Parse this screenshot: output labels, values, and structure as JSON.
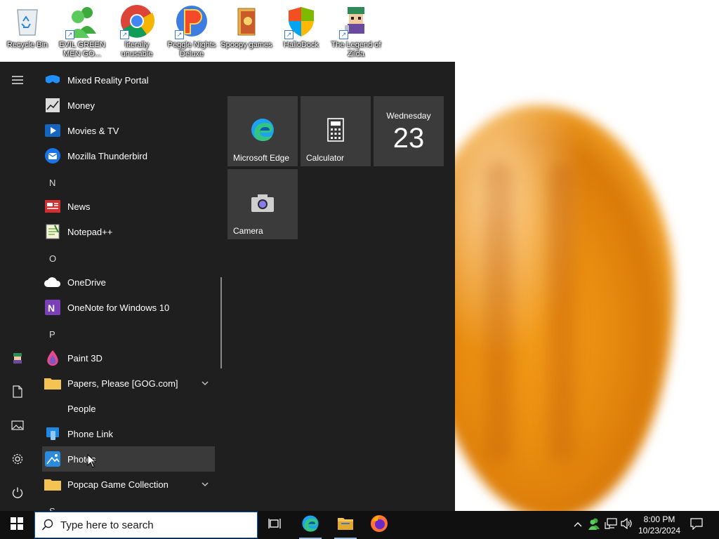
{
  "desktop": {
    "icons": [
      {
        "label": "Recycle Bin",
        "icon": "recycle-bin-icon"
      },
      {
        "label": "EVIL GREEN MEN GO...",
        "icon": "green-people-icon"
      },
      {
        "label": "literally unusable",
        "icon": "chrome-icon"
      },
      {
        "label": "Peggle Nights Deluxe",
        "icon": "peggle-icon"
      },
      {
        "label": "Spoopy games",
        "icon": "folder-icon"
      },
      {
        "label": "HalloDock",
        "icon": "shield-icon"
      },
      {
        "label": "The Legend of Zilda",
        "icon": "pixel-character-icon"
      }
    ]
  },
  "start_menu": {
    "apps": [
      {
        "label": "Mixed Reality Portal",
        "icon": "mixed-reality-icon"
      },
      {
        "label": "Money",
        "icon": "money-chart-icon"
      },
      {
        "label": "Movies & TV",
        "icon": "movies-tv-icon"
      },
      {
        "label": "Mozilla Thunderbird",
        "icon": "thunderbird-icon"
      },
      {
        "label": "N",
        "header": true
      },
      {
        "label": "News",
        "icon": "news-icon"
      },
      {
        "label": "Notepad++",
        "icon": "notepadpp-icon"
      },
      {
        "label": "O",
        "header": true
      },
      {
        "label": "OneDrive",
        "icon": "onedrive-icon"
      },
      {
        "label": "OneNote for Windows 10",
        "icon": "onenote-icon"
      },
      {
        "label": "P",
        "header": true
      },
      {
        "label": "Paint 3D",
        "icon": "paint3d-icon"
      },
      {
        "label": "Papers, Please [GOG.com]",
        "icon": "folder-icon",
        "expandable": true
      },
      {
        "label": "People",
        "icon": "people-icon"
      },
      {
        "label": "Phone Link",
        "icon": "phone-link-icon"
      },
      {
        "label": "Photos",
        "icon": "photos-icon",
        "hovered": true
      },
      {
        "label": "Popcap Game Collection",
        "icon": "folder-icon",
        "expandable": true
      },
      {
        "label": "S",
        "header": true
      }
    ],
    "tiles": [
      {
        "label": "Microsoft Edge",
        "icon": "edge-icon"
      },
      {
        "label": "Calculator",
        "icon": "calculator-icon"
      },
      {
        "day": "Wednesday",
        "date": "23"
      },
      {
        "label": "Camera",
        "icon": "camera-icon"
      }
    ]
  },
  "taskbar": {
    "search_placeholder": "Type here to search",
    "pinned": [
      "task-view-icon",
      "edge-icon",
      "file-explorer-icon",
      "firefox-icon"
    ],
    "clock_time": "8:00 PM",
    "clock_date": "10/23/2024"
  },
  "colors": {
    "start_bg": "#1f1f1f",
    "tile_bg": "#3b3b3b",
    "taskbar_bg": "#101010",
    "accent": "#0063b1",
    "wallpaper_orange": "#f29a18"
  }
}
